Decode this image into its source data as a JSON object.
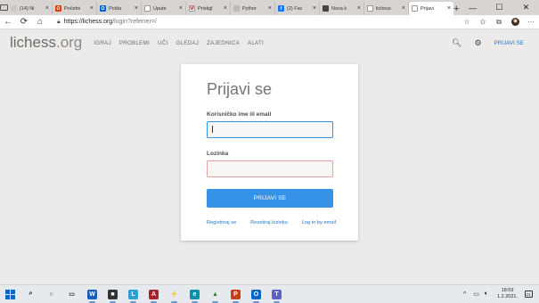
{
  "browser": {
    "tabs": [
      {
        "title": "(14) Ni",
        "fav_color": "#c8c8c8",
        "fav_glyph": ""
      },
      {
        "title": "Početni",
        "fav_color": "#d83b01",
        "fav_glyph": "O"
      },
      {
        "title": "Pošta",
        "fav_color": "#0a64c9",
        "fav_glyph": "O"
      },
      {
        "title": "Upute",
        "fav_color": "#ffffff",
        "fav_glyph": ""
      },
      {
        "title": "Pristigl",
        "fav_color": "#ffffff",
        "fav_glyph": "M"
      },
      {
        "title": "Pythor",
        "fav_color": "#bbbbbb",
        "fav_glyph": ""
      },
      {
        "title": "(2) Fac",
        "fav_color": "#1877f2",
        "fav_glyph": "f"
      },
      {
        "title": "Nova k",
        "fav_color": "#444444",
        "fav_glyph": ""
      },
      {
        "title": "lichess",
        "fav_color": "#ffffff",
        "fav_glyph": ""
      },
      {
        "title": "Prijavi",
        "fav_color": "#ffffff",
        "fav_glyph": ""
      }
    ],
    "new_tab": "+",
    "window_controls": {
      "minimize": "—",
      "maximize": "☐",
      "close": "✕"
    },
    "address": {
      "host": "https://lichess.org",
      "path": "/login?referrer=/"
    }
  },
  "site": {
    "logo": {
      "name": "lichess",
      "tld": ".org"
    },
    "nav": [
      "IGRAJ",
      "PROBLEMI",
      "UČI",
      "GLEDAJ",
      "ZAJEDNICA",
      "ALATI"
    ],
    "sign_in": "PRIJAVI SE"
  },
  "login": {
    "title": "Prijavi se",
    "username_label": "Korisničko ime ili email",
    "username_value": "",
    "password_label": "Lozinka",
    "password_value": "",
    "submit": "PRIJAVI SE",
    "links": {
      "register": "Registriraj se",
      "reset": "Resetiraj lozinku",
      "email_login": "Log in by email"
    }
  },
  "taskbar": {
    "apps": [
      {
        "name": "search",
        "glyph": "⌕",
        "color": "transparent",
        "text_color": "#222"
      },
      {
        "name": "task-view",
        "glyph": "○",
        "color": "transparent",
        "text_color": "#222"
      },
      {
        "name": "file-explorer",
        "glyph": "▭",
        "color": "transparent",
        "text_color": "#222"
      },
      {
        "name": "word",
        "glyph": "W",
        "color": "#1d5bb8",
        "text_color": "#fff"
      },
      {
        "name": "store",
        "glyph": "■",
        "color": "#333333",
        "text_color": "#fff"
      },
      {
        "name": "learning",
        "glyph": "L",
        "color": "#2d9fd8",
        "text_color": "#fff"
      },
      {
        "name": "access",
        "glyph": "A",
        "color": "#a4262c",
        "text_color": "#fff"
      },
      {
        "name": "python",
        "glyph": "⚡",
        "color": "transparent",
        "text_color": "#444"
      },
      {
        "name": "edge",
        "glyph": "e",
        "color": "#0f8ea8",
        "text_color": "#fff"
      },
      {
        "name": "photos",
        "glyph": "▲",
        "color": "transparent",
        "text_color": "#2e7d32"
      },
      {
        "name": "powerpoint",
        "glyph": "P",
        "color": "#c43e1c",
        "text_color": "#fff"
      },
      {
        "name": "outlook",
        "glyph": "O",
        "color": "#0a64c9",
        "text_color": "#fff"
      },
      {
        "name": "teams",
        "glyph": "T",
        "color": "#5b5fc7",
        "text_color": "#fff"
      }
    ],
    "clock_time": "18:59",
    "clock_date": "1.2.2021.",
    "notifications": "21"
  }
}
